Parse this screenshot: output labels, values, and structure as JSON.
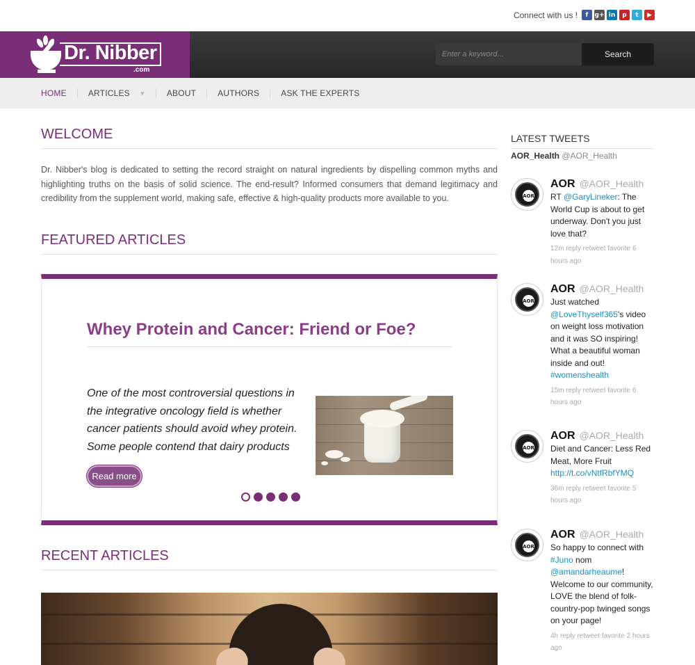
{
  "topbar": {
    "connect_label": "Connect with us !",
    "social": [
      {
        "icon": "facebook-icon",
        "glyph": "f",
        "color": "#3b5998"
      },
      {
        "icon": "google-plus-icon",
        "glyph": "g+",
        "color": "#555555"
      },
      {
        "icon": "linkedin-icon",
        "glyph": "in",
        "color": "#0e76a8"
      },
      {
        "icon": "pinterest-icon",
        "glyph": "p",
        "color": "#cb2027"
      },
      {
        "icon": "twitter-icon",
        "glyph": "t",
        "color": "#33aadd"
      },
      {
        "icon": "youtube-icon",
        "glyph": "▶",
        "color": "#c4302b"
      }
    ]
  },
  "logo": {
    "name": "Dr. Nibber",
    "tld": ".com"
  },
  "search": {
    "placeholder": "Enter a keyword...",
    "button_label": "Search"
  },
  "nav": {
    "items": [
      {
        "label": "HOME",
        "active": true
      },
      {
        "label": "ARTICLES",
        "dropdown": true
      },
      {
        "label": "ABOUT"
      },
      {
        "label": "AUTHORS"
      },
      {
        "label": "ASK THE EXPERTS"
      }
    ]
  },
  "welcome": {
    "title": "WELCOME",
    "text": "Dr. Nibber's blog is dedicated to setting the record straight on natural ingredients by dispelling common myths and highlighting truths on the basis of solid science. The end-result? Informed consumers that demand legitimacy and credibility from the supplement world, making safe, effective & high-quality products more available to you."
  },
  "featured": {
    "title": "FEATURED ARTICLES",
    "slide": {
      "title": "Whey Protein and Cancer: Friend or Foe?",
      "excerpt": "One of the most controversial questions in the integrative oncology field is whether cancer patients should avoid whey protein. Some people contend that dairy products",
      "read_more": "Read more"
    },
    "dots": [
      true,
      false,
      false,
      false,
      false
    ]
  },
  "recent": {
    "title": "RECENT ARTICLES"
  },
  "colors": {
    "accent": "#7b2e78",
    "link": "#1a8fc4",
    "header_dark": "#2b2b2b"
  },
  "tweets": {
    "title": "LATEST TWEETS",
    "user_name": "AOR_Health",
    "user_handle": "@AOR_Health",
    "items": [
      {
        "name": "AOR",
        "handle": "@AOR_Health",
        "parts": [
          [
            "RT ",
            false
          ],
          [
            "@GaryLineker",
            true
          ],
          [
            ": The World Cup is about to get underway. Don't you just love that?",
            false
          ]
        ],
        "meta": "12m reply retweet favorite 6 hours ago"
      },
      {
        "name": "AOR",
        "handle": "@AOR_Health",
        "parts": [
          [
            "Just watched ",
            false
          ],
          [
            "@LoveThyself365",
            true
          ],
          [
            "'s video on weight loss motivation and it was SO inspiring! What a beautiful woman inside and out! ",
            false
          ],
          [
            "#womenshealth",
            true
          ]
        ],
        "meta": "15m reply retweet favorite 6 hours ago"
      },
      {
        "name": "AOR",
        "handle": "@AOR_Health",
        "parts": [
          [
            "Diet and Cancer: Less Red Meat, More Fruit ",
            false
          ],
          [
            "http://t.co/vNtfRbfYMQ",
            true
          ]
        ],
        "meta": "36m reply retweet favorite 5 hours ago"
      },
      {
        "name": "AOR",
        "handle": "@AOR_Health",
        "parts": [
          [
            "So happy to connect with ",
            false
          ],
          [
            "#Juno",
            true
          ],
          [
            " nom ",
            false
          ],
          [
            "@amandarheaume",
            true
          ],
          [
            "! Welcome to our community, LOVE the blend of folk-country-pop twinged songs on your page!",
            false
          ]
        ],
        "meta": "4h reply retweet favorite 2 hours ago"
      }
    ]
  }
}
